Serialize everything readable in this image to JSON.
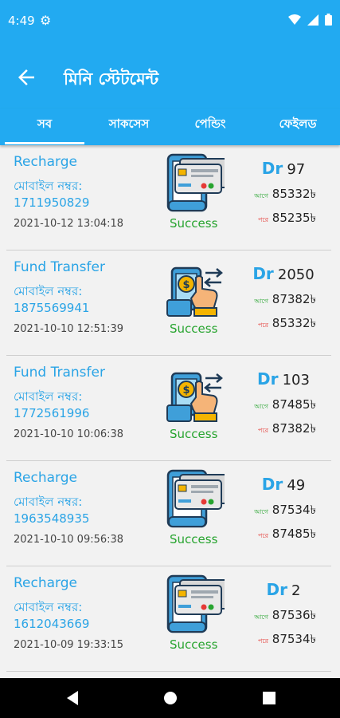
{
  "status_bar": {
    "time": "4:49"
  },
  "app_bar": {
    "title": "মিনি স্টেটমেন্ট"
  },
  "tabs": [
    {
      "label": "সব"
    },
    {
      "label": "সাকসেস"
    },
    {
      "label": "পেন্ডিং"
    },
    {
      "label": "ফেইলড"
    }
  ],
  "labels": {
    "mobile": "মোবাইল নম্বর:",
    "dr": "Dr",
    "before": "আগে",
    "after": "পরে"
  },
  "transactions": [
    {
      "type": "Recharge",
      "mobile": "1711950829",
      "date": "2021-10-12 13:04:18",
      "status": "Success",
      "amount": "97",
      "before": "85332৳",
      "after": "85235৳",
      "icon": "recharge-icon"
    },
    {
      "type": "Fund Transfer",
      "mobile": "1875569941",
      "date": "2021-10-10 12:51:39",
      "status": "Success",
      "amount": "2050",
      "before": "87382৳",
      "after": "85332৳",
      "icon": "fund-transfer-icon"
    },
    {
      "type": "Fund Transfer",
      "mobile": "1772561996",
      "date": "2021-10-10 10:06:38",
      "status": "Success",
      "amount": "103",
      "before": "87485৳",
      "after": "87382৳",
      "icon": "fund-transfer-icon"
    },
    {
      "type": "Recharge",
      "mobile": "1963548935",
      "date": "2021-10-10 09:56:38",
      "status": "Success",
      "amount": "49",
      "before": "87534৳",
      "after": "87485৳",
      "icon": "recharge-icon"
    },
    {
      "type": "Recharge",
      "mobile": "1612043669",
      "date": "2021-10-09 19:33:15",
      "status": "Success",
      "amount": "2",
      "before": "87536৳",
      "after": "87534৳",
      "icon": "recharge-icon"
    }
  ],
  "colors": {
    "primary": "#22aaf1",
    "success": "#27a42f",
    "before": "#27a42f",
    "after": "#e53935"
  }
}
